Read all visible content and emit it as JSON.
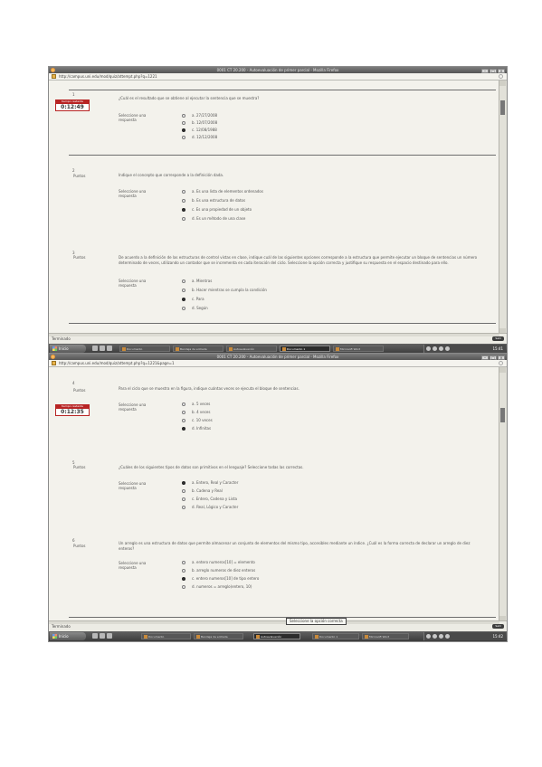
{
  "screenshots": [
    {
      "window_title": "0001 CT 20.200 - Autoevaluación de primer parcial - Mozilla Firefox",
      "url": "http://campus.uni.edu/mod/quiz/attempt.php?q=1221",
      "timer": {
        "label": "tiempo restante",
        "value": "0:12:49"
      },
      "status_text": "Terminado",
      "status_pill": "Salir",
      "clock": "15:41",
      "taskbar": [
        "Inicio",
        "Documento",
        "Bandeja de entrada",
        "Autoevaluación",
        "Documento 1",
        "Microsoft Word"
      ],
      "questions": [
        {
          "number": "1",
          "points": "",
          "text": "¿Cuál es el resultado que se obtiene al ejecutar la sentencia que se muestra?",
          "select_label": "Seleccione una respuesta",
          "options": [
            "a. 27/27/2008",
            "b. 12/07/2008",
            "c. 12/08/1988",
            "d. 12/12/2008"
          ],
          "selected": 2
        },
        {
          "number": "2",
          "points": "Puntos",
          "text": "Indique el concepto que corresponde a la definición dada.",
          "select_label": "Seleccione una respuesta",
          "options": [
            "a. Es una lista de elementos ordenados",
            "b. Es una estructura de datos",
            "c. Es una propiedad de un objeto",
            "d. Es un método de una clase"
          ],
          "selected": 2
        },
        {
          "number": "3",
          "points": "Puntos",
          "text": "De acuerdo a la definición de las estructuras de control vistas en clase, indique cuál de las siguientes opciones corresponde a la estructura que permite ejecutar un bloque de sentencias un número determinado de veces, utilizando un contador que se incrementa en cada iteración del ciclo. Seleccione la opción correcta y justifique su respuesta en el espacio destinado para ello.",
          "select_label": "Seleccione una respuesta",
          "options": [
            "a. Mientras",
            "b. Hacer mientras se cumpla la condición",
            "c. Para",
            "d. Según"
          ],
          "selected": 2
        }
      ]
    },
    {
      "window_title": "0001 CT 20.200 - Autoevaluación de primer parcial - Mozilla Firefox",
      "url": "http://campus.uni.edu/mod/quiz/attempt.php?q=1221&page=1",
      "timer": {
        "label": "tiempo restante",
        "value": "0:12:35"
      },
      "status_text": "Terminado",
      "status_pill": "Salir",
      "popup": "Seleccione la opción correcta",
      "clock": "15:42",
      "taskbar": [
        "Inicio",
        "Documento",
        "Bandeja de entrada",
        "Autoevaluación",
        "Documento 1",
        "Microsoft Word"
      ],
      "questions": [
        {
          "number": "4",
          "points": "Puntos",
          "text": "Para el ciclo que se muestra en la figura, indique cuántas veces se ejecuta el bloque de sentencias.",
          "select_label": "Seleccione una respuesta",
          "options": [
            "a. 5 veces",
            "b. 4 veces",
            "c. 10 veces",
            "d. Infinitas"
          ],
          "selected": 3
        },
        {
          "number": "5",
          "points": "Puntos",
          "text": "¿Cuáles de los siguientes tipos de datos son primitivos en el lenguaje? Seleccione todas las correctas.",
          "select_label": "Seleccione una respuesta",
          "options": [
            "a. Entero, Real y Caracter",
            "b. Cadena y Real",
            "c. Entero, Cadena y Lista",
            "d. Real, Lógico y Caracter"
          ],
          "selected": 0
        },
        {
          "number": "6",
          "points": "Puntos",
          "text": "Un arreglo es una estructura de datos que permite almacenar un conjunto de elementos del mismo tipo, accesibles mediante un índice. ¿Cuál es la forma correcta de declarar un arreglo de diez enteros?",
          "select_label": "Seleccione una respuesta",
          "options": [
            "a. entero numeros[10] = elemento",
            "b. arreglo numeros de diez enteros",
            "c. entero numeros[10] de tipo entero",
            "d. numeros = arreglo(entero, 10)"
          ],
          "selected": 2
        }
      ]
    }
  ]
}
